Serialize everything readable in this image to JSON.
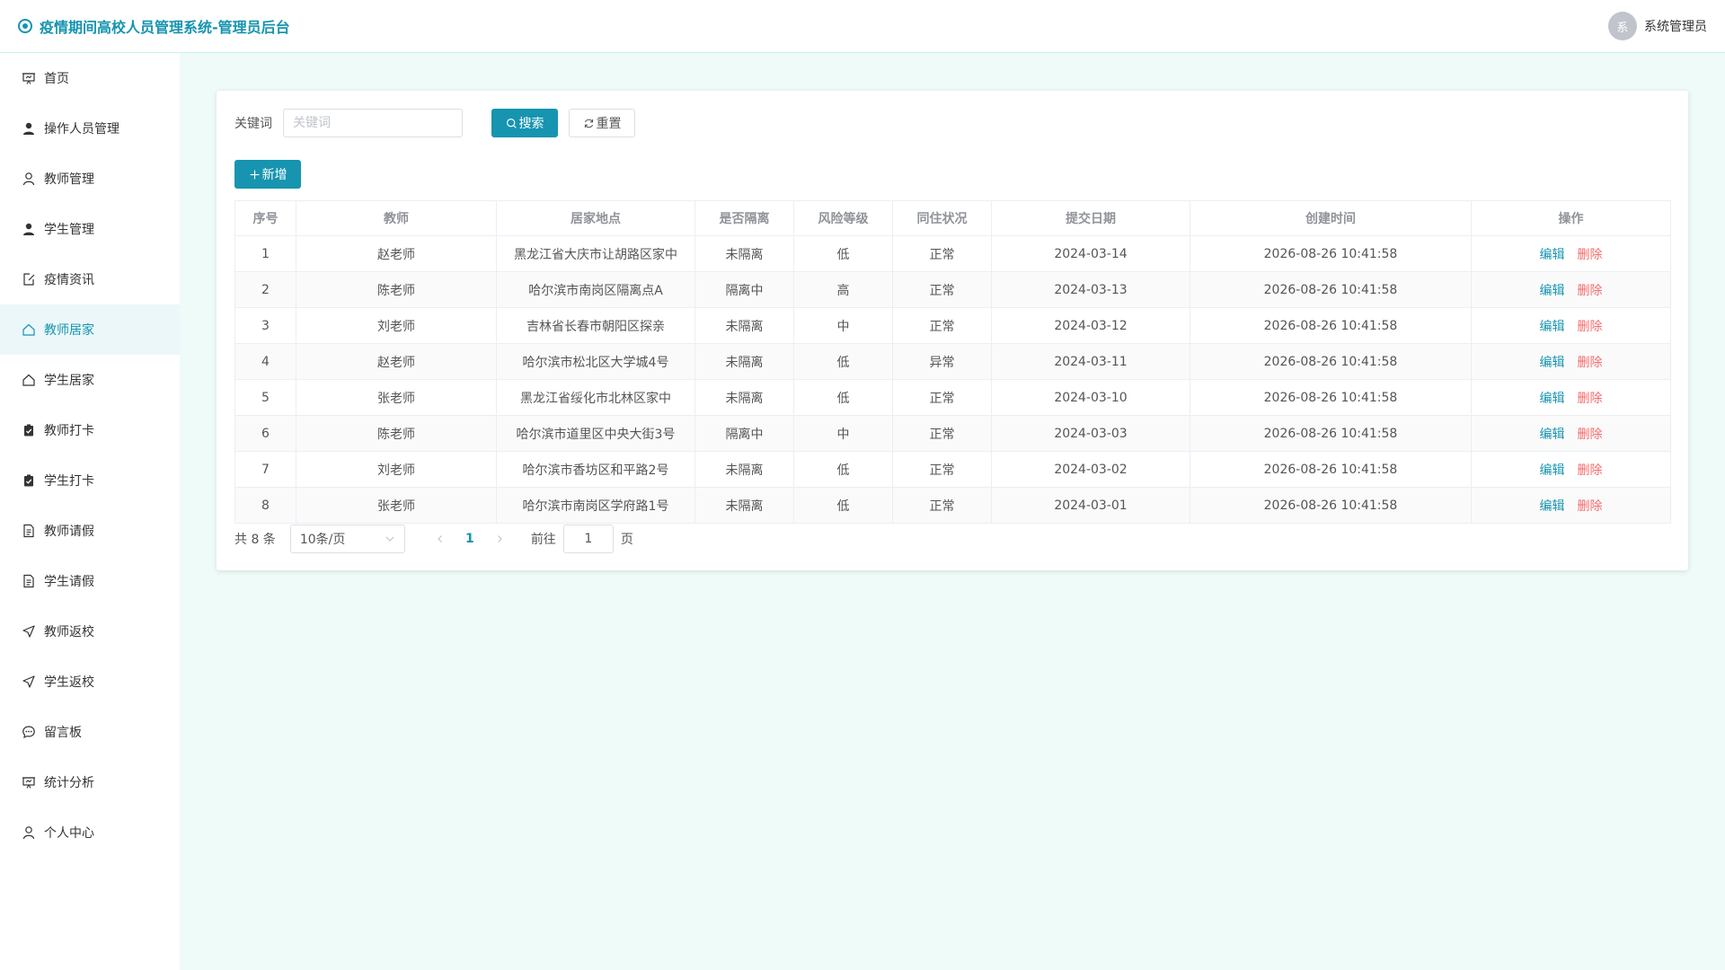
{
  "header": {
    "title": "疫情期间高校人员管理系统-管理员后台",
    "avatar_text": "系",
    "user_name": "系统管理员"
  },
  "colors": {
    "accent": "#1694b0",
    "danger": "#f56c6c",
    "background": "#eefbf9",
    "active_bg": "#ecf7f9"
  },
  "sidebar": {
    "items": [
      {
        "label": "首页",
        "icon": "home-icon"
      },
      {
        "label": "操作人员管理",
        "icon": "user-fill-icon"
      },
      {
        "label": "教师管理",
        "icon": "user-icon"
      },
      {
        "label": "学生管理",
        "icon": "user-fill-icon"
      },
      {
        "label": "疫情资讯",
        "icon": "document-edit-icon"
      },
      {
        "label": "教师居家",
        "icon": "house-icon",
        "active": true
      },
      {
        "label": "学生居家",
        "icon": "house-icon"
      },
      {
        "label": "教师打卡",
        "icon": "checked-icon"
      },
      {
        "label": "学生打卡",
        "icon": "checked-icon"
      },
      {
        "label": "教师请假",
        "icon": "document-icon"
      },
      {
        "label": "学生请假",
        "icon": "document-icon"
      },
      {
        "label": "教师返校",
        "icon": "position-icon"
      },
      {
        "label": "学生返校",
        "icon": "position-icon"
      },
      {
        "label": "留言板",
        "icon": "chat-icon"
      },
      {
        "label": "统计分析",
        "icon": "data-board-icon"
      },
      {
        "label": "个人中心",
        "icon": "user-icon"
      }
    ]
  },
  "search": {
    "label": "关键词",
    "placeholder": "关键词",
    "value": "",
    "search_label": "搜索",
    "reset_label": "重置"
  },
  "toolbar": {
    "add_label": "新增"
  },
  "table": {
    "columns": [
      "序号",
      "教师",
      "居家地点",
      "是否隔离",
      "风险等级",
      "同住状况",
      "提交日期",
      "创建时间",
      "操作"
    ],
    "edit_label": "编辑",
    "delete_label": "删除",
    "rows": [
      [
        "1",
        "赵老师",
        "黑龙江省大庆市让胡路区家中",
        "未隔离",
        "低",
        "正常",
        "2024-03-14",
        "2026-08-26 10:41:58"
      ],
      [
        "2",
        "陈老师",
        "哈尔滨市南岗区隔离点A",
        "隔离中",
        "高",
        "正常",
        "2024-03-13",
        "2026-08-26 10:41:58"
      ],
      [
        "3",
        "刘老师",
        "吉林省长春市朝阳区探亲",
        "未隔离",
        "中",
        "正常",
        "2024-03-12",
        "2026-08-26 10:41:58"
      ],
      [
        "4",
        "赵老师",
        "哈尔滨市松北区大学城4号",
        "未隔离",
        "低",
        "异常",
        "2024-03-11",
        "2026-08-26 10:41:58"
      ],
      [
        "5",
        "张老师",
        "黑龙江省绥化市北林区家中",
        "未隔离",
        "低",
        "正常",
        "2024-03-10",
        "2026-08-26 10:41:58"
      ],
      [
        "6",
        "陈老师",
        "哈尔滨市道里区中央大街3号",
        "隔离中",
        "中",
        "正常",
        "2024-03-03",
        "2026-08-26 10:41:58"
      ],
      [
        "7",
        "刘老师",
        "哈尔滨市香坊区和平路2号",
        "未隔离",
        "低",
        "正常",
        "2024-03-02",
        "2026-08-26 10:41:58"
      ],
      [
        "8",
        "张老师",
        "哈尔滨市南岗区学府路1号",
        "未隔离",
        "低",
        "正常",
        "2024-03-01",
        "2026-08-26 10:41:58"
      ]
    ]
  },
  "pagination": {
    "total_text": "共 8 条",
    "page_size": "10条/页",
    "current_page": "1",
    "goto_label": "前往",
    "goto_value": "1",
    "page_suffix": "页"
  }
}
